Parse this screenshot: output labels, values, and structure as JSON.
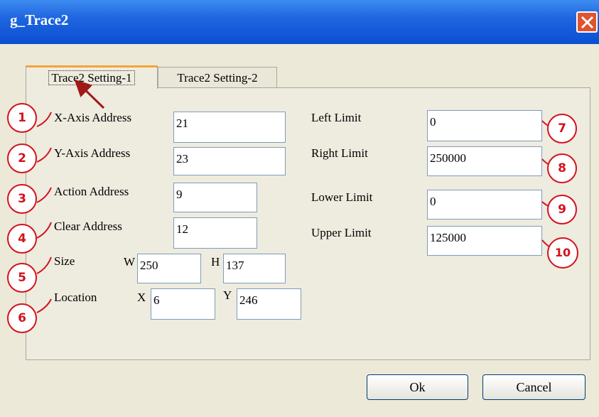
{
  "window": {
    "title": "g_Trace2"
  },
  "tabs": [
    {
      "label": "Trace2 Setting-1",
      "active": true
    },
    {
      "label": "Trace2 Setting-2",
      "active": false
    }
  ],
  "fields": {
    "x_axis": {
      "label": "X-Axis Address",
      "value": "21"
    },
    "y_axis": {
      "label": "Y-Axis Address",
      "value": "23"
    },
    "action": {
      "label": "Action Address",
      "value": "9"
    },
    "clear": {
      "label": "Clear Address",
      "value": "12"
    },
    "size": {
      "label": "Size",
      "w_label": "W",
      "w_value": "250",
      "h_label": "H",
      "h_value": "137"
    },
    "location": {
      "label": "Location",
      "x_label": "X",
      "x_value": "6",
      "y_label": "Y",
      "y_value": "246"
    },
    "left_limit": {
      "label": "Left Limit",
      "value": "0"
    },
    "right_limit": {
      "label": "Right Limit",
      "value": "250000"
    },
    "lower_limit": {
      "label": "Lower Limit",
      "value": "0"
    },
    "upper_limit": {
      "label": "Upper Limit",
      "value": "125000"
    }
  },
  "callouts": [
    "1",
    "2",
    "3",
    "4",
    "5",
    "6",
    "7",
    "8",
    "9",
    "10"
  ],
  "buttons": {
    "ok": "Ok",
    "cancel": "Cancel"
  },
  "colors": {
    "title_bar": "#0a4fd2",
    "callout": "#d4121c",
    "dialog_bg": "#ece9d8",
    "close": "#e0532f"
  }
}
